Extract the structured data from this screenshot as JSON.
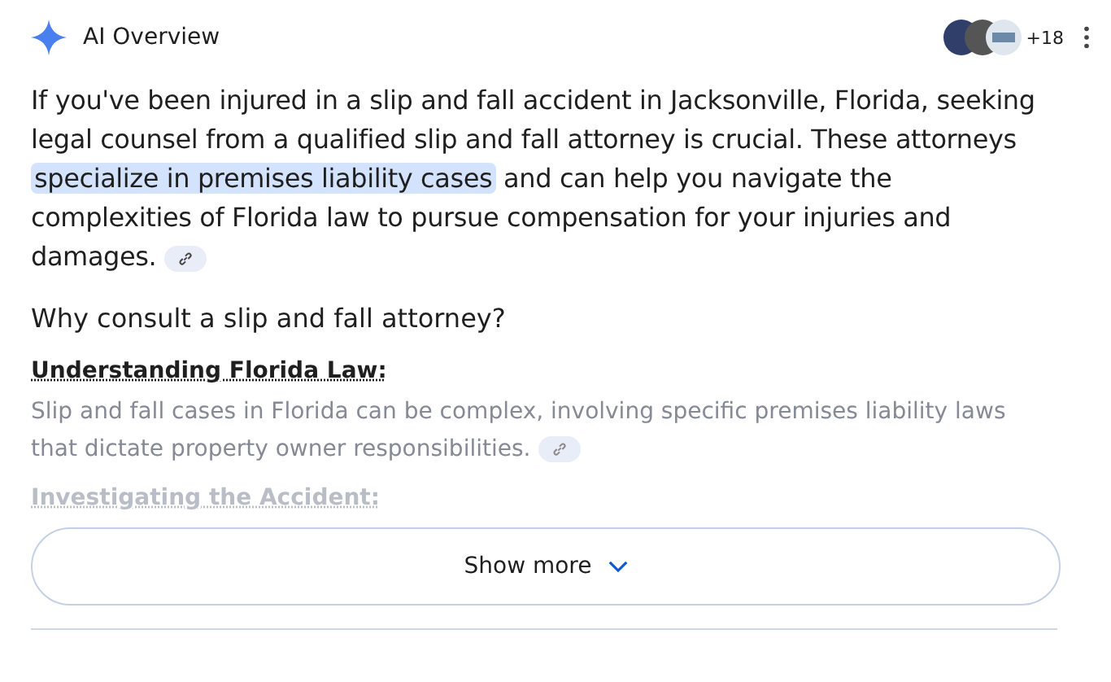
{
  "header": {
    "title": "AI Overview",
    "source_count": "+18"
  },
  "intro": {
    "before": "If you've been injured in a slip and fall accident in Jacksonville, Florida, seeking legal counsel from a qualified slip and fall attorney is crucial. These attorneys ",
    "highlight": "specialize in premises liability cases",
    "after": " and can help you navigate the complexities of Florida law to pursue compensation for your injuries and damages."
  },
  "heading": "Why consult a slip and fall attorney?",
  "sections": [
    {
      "title": "Understanding Florida Law:",
      "text": "Slip and fall cases in Florida can be complex, involving specific premises liability laws that dictate property owner responsibilities."
    },
    {
      "title": "Investigating the Accident:"
    }
  ],
  "show_more": {
    "label": "Show more"
  }
}
